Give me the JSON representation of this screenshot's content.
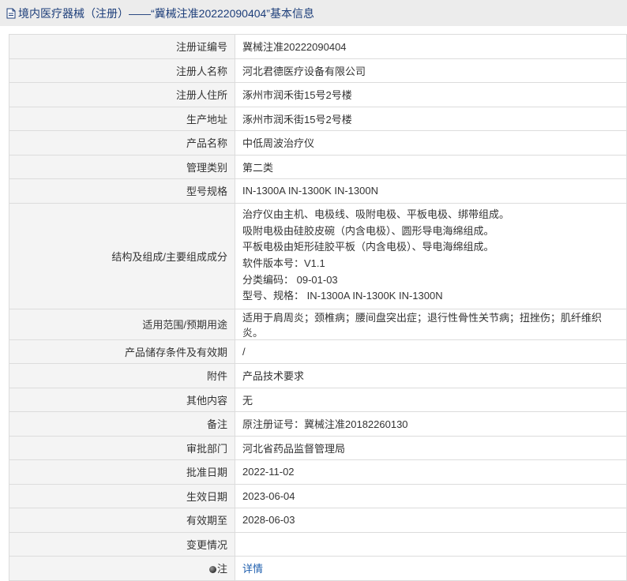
{
  "header": {
    "title": "境内医疗器械（注册）——“冀械注准20222090404”基本信息"
  },
  "rows": [
    {
      "label": "注册证编号",
      "value": "冀械注准20222090404"
    },
    {
      "label": "注册人名称",
      "value": "河北君德医疗设备有限公司"
    },
    {
      "label": "注册人住所",
      "value": "涿州市润禾街15号2号楼"
    },
    {
      "label": "生产地址",
      "value": "涿州市润禾街15号2号楼"
    },
    {
      "label": "产品名称",
      "value": "中低周波治疗仪"
    },
    {
      "label": "管理类别",
      "value": "第二类"
    },
    {
      "label": "型号规格",
      "value": "IN-1300A IN-1300K IN-1300N"
    },
    {
      "label": "结构及组成/主要组成成分",
      "lines": [
        "治疗仪由主机、电极线、吸附电极、平板电极、绑带组成。",
        "吸附电极由硅胶皮碗（内含电极）、圆形导电海绵组成。",
        "平板电极由矩形硅胶平板（内含电极）、导电海绵组成。",
        "软件版本号：V1.1",
        "分类编码： 09-01-03",
        "型号、规格： IN-1300A IN-1300K IN-1300N"
      ]
    },
    {
      "label": "适用范围/预期用途",
      "value": "适用于肩周炎；颈椎病；腰间盘突出症；退行性骨性关节病；扭挫伤；肌纤维织炎。"
    },
    {
      "label": "产品储存条件及有效期",
      "value": "/"
    },
    {
      "label": "附件",
      "value": "产品技术要求"
    },
    {
      "label": "其他内容",
      "value": "无"
    },
    {
      "label": "备注",
      "value": "原注册证号：冀械注准20182260130"
    },
    {
      "label": "审批部门",
      "value": "河北省药品监督管理局"
    },
    {
      "label": "批准日期",
      "value": "2022-11-02"
    },
    {
      "label": "生效日期",
      "value": "2023-06-04"
    },
    {
      "label": "有效期至",
      "value": "2028-06-03"
    },
    {
      "label": "变更情况",
      "value": ""
    },
    {
      "label": "注",
      "value": "详情"
    }
  ]
}
